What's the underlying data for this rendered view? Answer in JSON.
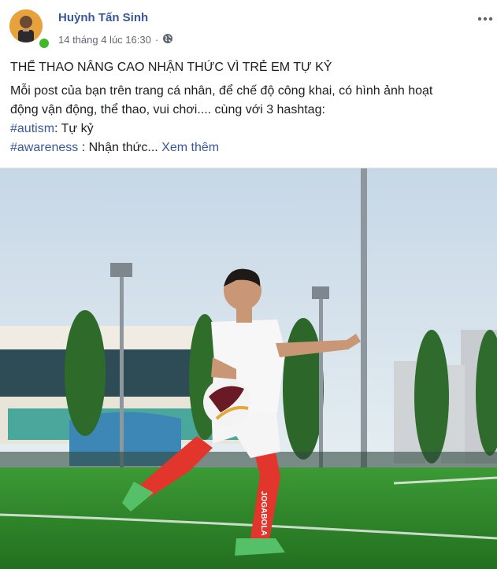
{
  "post": {
    "author_name": "Huỳnh Tấn Sinh",
    "timestamp": "14 tháng 4 lúc 16:30",
    "separator": "·",
    "privacy_icon": "globe-icon",
    "more_icon": "more-options-icon",
    "online_status": "online",
    "title_line": "THỂ THAO NÂNG CAO NHẬN THỨC VÌ TRẺ EM TỰ KỶ",
    "body_line_1": "Mỗi post của bạn trên trang cá nhân, để chế độ công khai, có hình ảnh hoạt",
    "body_line_2": "động vận động, thể thao, vui chơi.... cùng với 3 hashtag:",
    "hashtag_1": "#autism",
    "hashtag_1_desc": ": Tự kỷ",
    "hashtag_2": "#awareness",
    "hashtag_2_desc": " : Nhận thức...",
    "see_more": "Xem thêm",
    "jersey_text": "JOGABOLA"
  },
  "colors": {
    "link": "#385898",
    "text": "#1c1e21",
    "meta": "#616770",
    "online": "#42b72a",
    "jersey_red": "#e2352b",
    "pitch_green": "#2f8a2a"
  }
}
